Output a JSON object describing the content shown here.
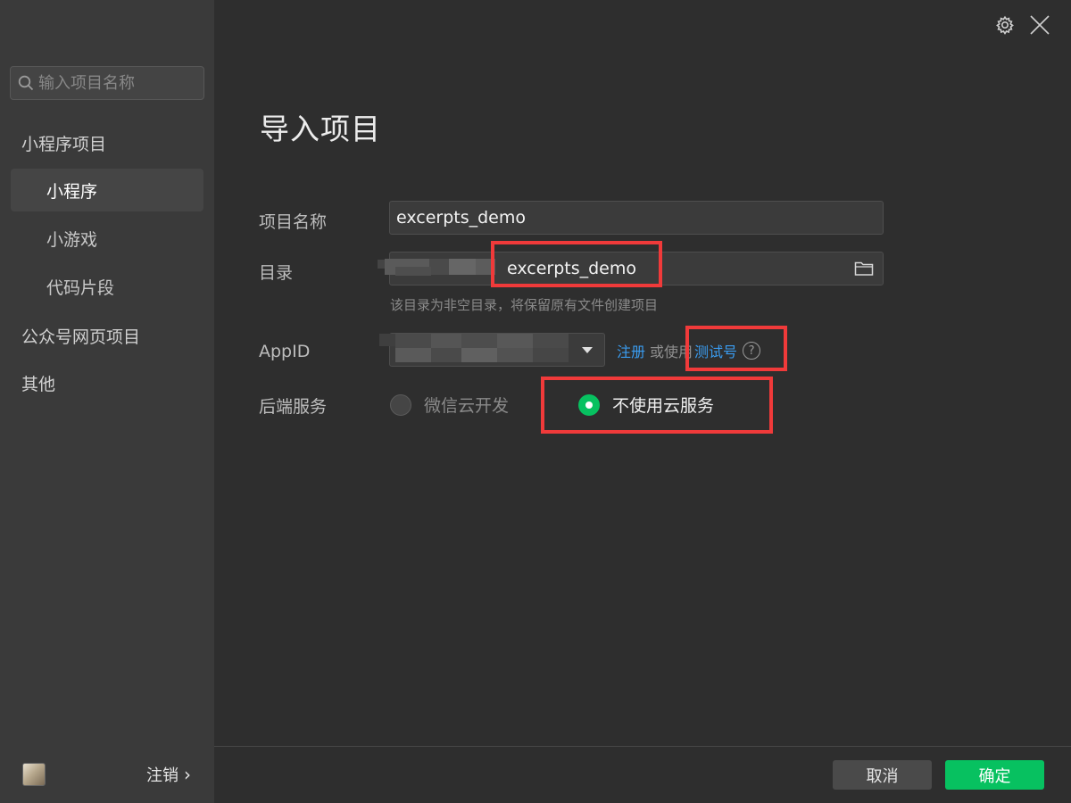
{
  "sidebar": {
    "search_placeholder": "输入项目名称",
    "groups": {
      "mini_program": "小程序项目",
      "official_web": "公众号网页项目",
      "other": "其他"
    },
    "items": [
      {
        "label": "小程序",
        "active": true
      },
      {
        "label": "小游戏",
        "active": false
      },
      {
        "label": "代码片段",
        "active": false
      }
    ],
    "logout_label": "注销",
    "logout_chevron": "›"
  },
  "main": {
    "title": "导入项目",
    "form": {
      "project_name_label": "项目名称",
      "project_name_value": "excerpts_demo",
      "directory_label": "目录",
      "directory_value": "excerpts_demo",
      "directory_hint": "该目录为非空目录，将保留原有文件创建项目",
      "appid_label": "AppID",
      "register_link": "注册",
      "or_use": "或使用",
      "test_account_link": "测试号",
      "help_icon_text": "?",
      "backend_label": "后端服务",
      "backend_options": [
        {
          "label": "微信云开发",
          "selected": false
        },
        {
          "label": "不使用云服务",
          "selected": true
        }
      ]
    }
  },
  "footer": {
    "cancel_label": "取消",
    "confirm_label": "确定"
  },
  "colors": {
    "accent_green": "#07c160",
    "link_blue": "#3a9cf0",
    "highlight_red": "#f03a3a"
  },
  "icons": [
    "search-icon",
    "gear-icon",
    "close-icon",
    "folder-icon",
    "help-icon",
    "chevron-right-icon",
    "dropdown-caret-icon"
  ]
}
